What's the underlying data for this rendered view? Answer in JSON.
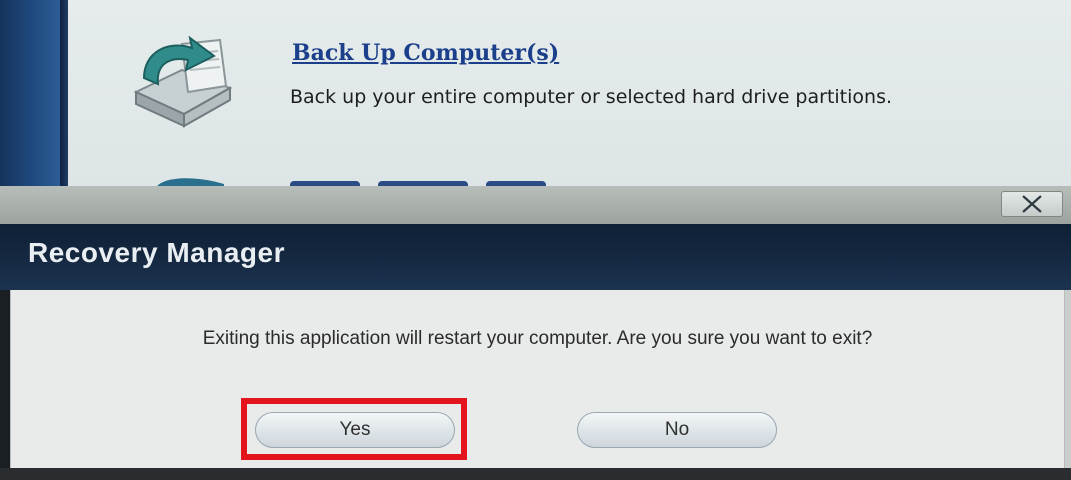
{
  "background_app": {
    "backup_link": "Back Up Computer(s)",
    "backup_description": "Back up your entire computer or selected hard drive partitions."
  },
  "dialog": {
    "title": "Recovery Manager",
    "message": "Exiting this application will restart your computer. Are you sure you want to exit?",
    "yes_label": "Yes",
    "no_label": "No",
    "close_icon": "close-icon"
  },
  "colors": {
    "title_bar": "#14273f",
    "highlight": "#e3141c",
    "link": "#1b3f8a"
  }
}
